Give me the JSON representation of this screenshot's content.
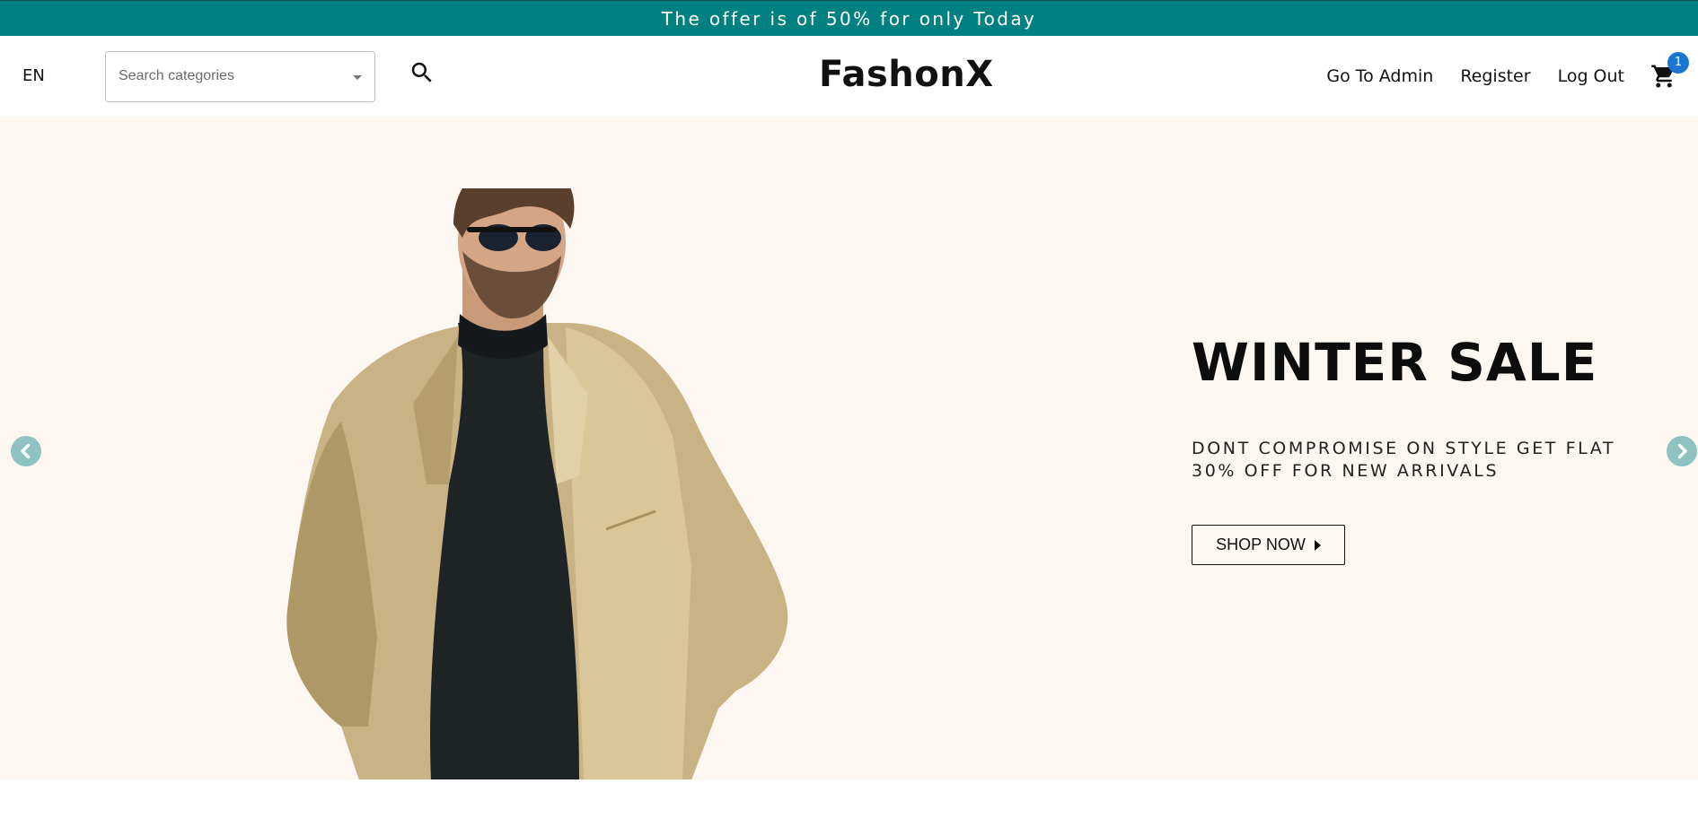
{
  "announcement": {
    "text": "The offer is of 50% for only Today"
  },
  "header": {
    "language": "EN",
    "search": {
      "placeholder": "Search categories",
      "search_icon": "search-icon",
      "dropdown_icon": "caret-down-icon"
    },
    "logo": "FashonX",
    "nav_links": [
      "Go To Admin",
      "Register",
      "Log Out"
    ],
    "cart": {
      "icon": "cart-icon",
      "count": "1",
      "badge_color": "#1976d2"
    }
  },
  "hero": {
    "title": "WINTER SALE",
    "description": "DONT COMPROMISE ON STYLE GET FLAT 30% OFF FOR NEW ARRIVALS",
    "cta_label": "SHOP NOW",
    "prev_icon": "chevron-left-icon",
    "next_icon": "chevron-right-icon",
    "image": "man-in-coat-and-sunglasses"
  },
  "colors": {
    "announcement_bg": "#008080",
    "hero_bg": "#fdf7f2",
    "arrow_bg": "#8ec3c2",
    "text": "#111111"
  }
}
